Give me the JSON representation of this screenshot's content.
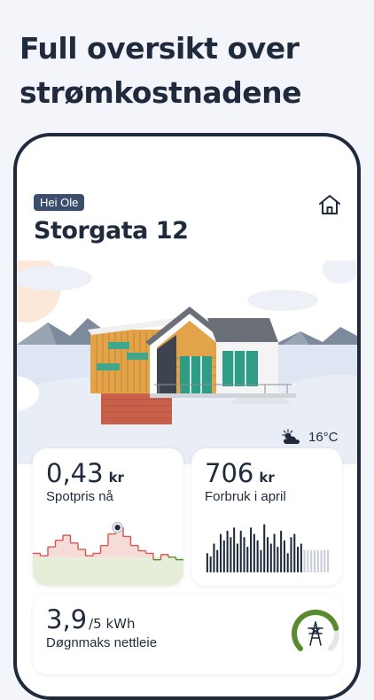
{
  "headline": "Full oversikt over strømkostnadene",
  "greeting": "Hei Ole",
  "address": "Storgata 12",
  "weather": {
    "temperature": "16°C",
    "icon": "partly-cloudy-icon"
  },
  "spot_card": {
    "value": "0,43",
    "unit": "kr",
    "label": "Spotpris nå"
  },
  "usage_card": {
    "value": "706",
    "unit": "kr",
    "label": "Forbruk i april"
  },
  "peak_card": {
    "value": "3,9",
    "unit": "/5 kWh",
    "label": "Døgnmaks nettleie",
    "fraction": 0.78
  },
  "colors": {
    "accent_red": "#d9534f",
    "accent_green": "#5a8a2f",
    "dark_navy": "#1f2b3d",
    "badge": "#3b4f6c",
    "bar_future": "#c9ced6"
  },
  "chart_data": [
    {
      "type": "line",
      "name": "spot",
      "values": [
        0.3,
        0.3,
        0.28,
        0.28,
        0.35,
        0.35,
        0.4,
        0.4,
        0.44,
        0.44,
        0.38,
        0.38,
        0.33,
        0.33,
        0.28,
        0.28,
        0.3,
        0.3,
        0.36,
        0.36,
        0.45,
        0.45,
        0.5,
        0.5,
        0.43,
        0.43,
        0.36,
        0.36,
        0.32,
        0.32,
        0.3,
        0.3,
        0.25,
        0.25,
        0.29,
        0.29,
        0.27,
        0.27,
        0.25,
        0.25
      ],
      "threshold": 0.27
    },
    {
      "type": "bar",
      "name": "usage",
      "values": [
        30,
        25,
        45,
        35,
        60,
        50,
        65,
        55,
        70,
        45,
        65,
        55,
        40,
        70,
        60,
        50,
        35,
        75,
        55,
        45,
        60,
        40,
        65,
        50,
        30,
        55,
        60,
        40,
        45,
        35,
        35,
        35,
        35,
        35,
        35,
        35,
        35
      ],
      "future_from": 29
    }
  ]
}
